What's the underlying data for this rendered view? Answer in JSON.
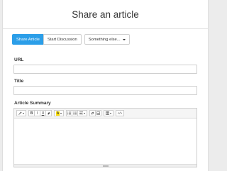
{
  "header": {
    "title": "Share an article"
  },
  "tabs": [
    {
      "label": "Share Article"
    },
    {
      "label": "Start Discussion"
    },
    {
      "label": "Something else..."
    }
  ],
  "form": {
    "url_label": "URL",
    "url_value": "",
    "title_label": "Title",
    "title_value": "",
    "summary_label": "Article Summary"
  },
  "toolbar": {
    "bold": "B",
    "italic": "I",
    "underline": "U",
    "font_color_letter": "A",
    "code": "</>"
  },
  "colors": {
    "accent": "#2b9ee8",
    "highlight": "#ffe100"
  }
}
